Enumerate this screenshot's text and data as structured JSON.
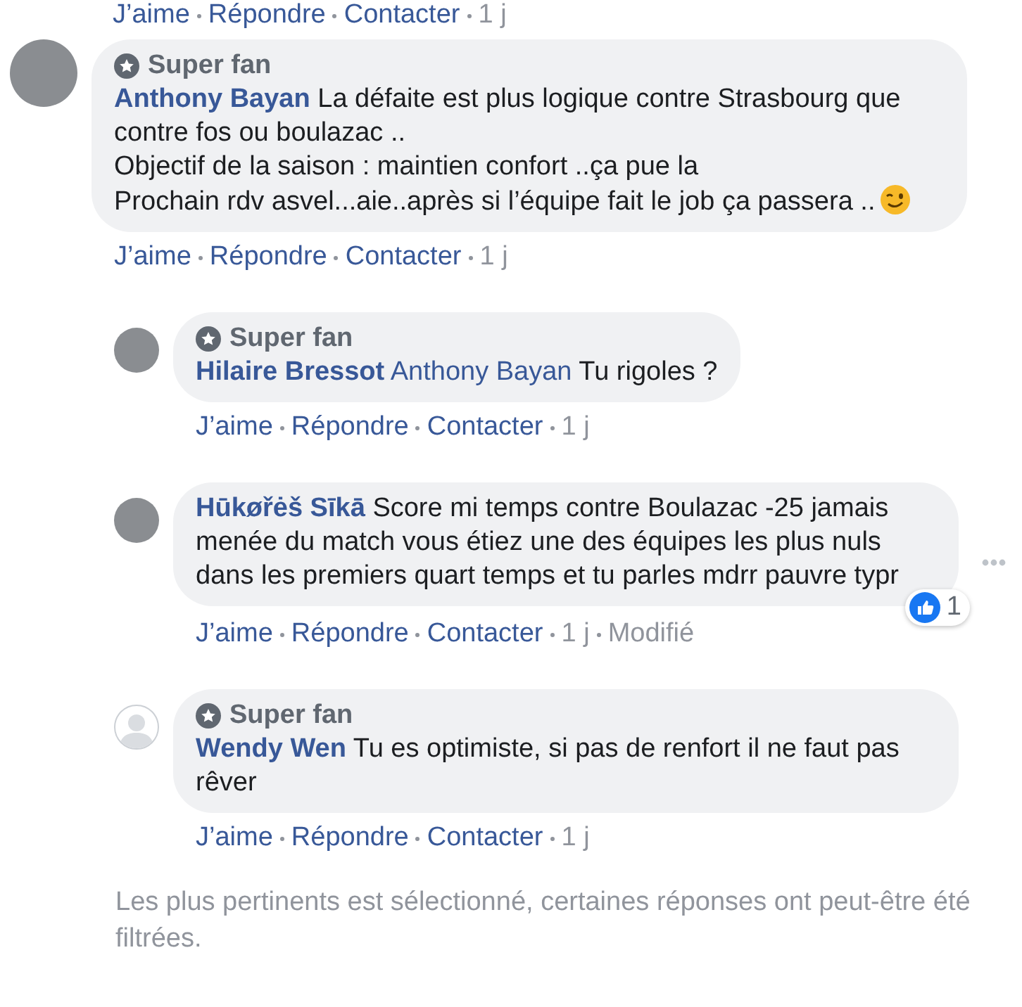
{
  "previous_actions": {
    "actions": [
      "J’aime",
      "Répondre",
      "Contacter"
    ],
    "time": "1 j"
  },
  "comments": [
    {
      "kind": "comment",
      "avatar": {
        "kind": "photo"
      },
      "badge": "Super fan",
      "author": "Anthony Bayan",
      "text": "La défaite est plus logique contre Strasbourg que contre fos ou boulazac ..\nObjectif de la saison : maintien confort ..ça pue la\nProchain rdv asvel...aie..après si l’équipe fait le job ça passera ..",
      "emoji": true,
      "actions": [
        "J’aime",
        "Répondre",
        "Contacter"
      ],
      "time": "1 j",
      "more_menu": false
    },
    {
      "kind": "reply",
      "avatar": {
        "kind": "photo"
      },
      "badge": "Super fan",
      "author": "Hilaire Bressot",
      "mention": "Anthony Bayan",
      "text": "Tu rigoles ?",
      "emoji": false,
      "actions": [
        "J’aime",
        "Répondre",
        "Contacter"
      ],
      "time": "1 j",
      "more_menu": false
    },
    {
      "kind": "reply",
      "avatar": {
        "kind": "photo"
      },
      "author": "Hūkøřėš Sīkā",
      "text": "Score mi temps contre Boulazac -25 jamais menée du match vous étiez une des équipes les plus nuls dans les premiers quart temps et tu parles mdrr pauvre typr",
      "emoji": false,
      "actions": [
        "J’aime",
        "Répondre",
        "Contacter"
      ],
      "time": "1 j",
      "edited": "Modifié",
      "reactions": "1",
      "more_menu": true
    },
    {
      "kind": "reply",
      "avatar": {
        "kind": "silhouette"
      },
      "badge": "Super fan",
      "author": "Wendy Wen",
      "text": "Tu es optimiste, si pas de renfort il ne faut pas rêver",
      "emoji": false,
      "actions": [
        "J’aime",
        "Répondre",
        "Contacter"
      ],
      "time": "1 j",
      "more_menu": false
    }
  ],
  "footer_note": "Les plus pertinents est sélectionné, certaines réponses ont peut-être été filtrées."
}
